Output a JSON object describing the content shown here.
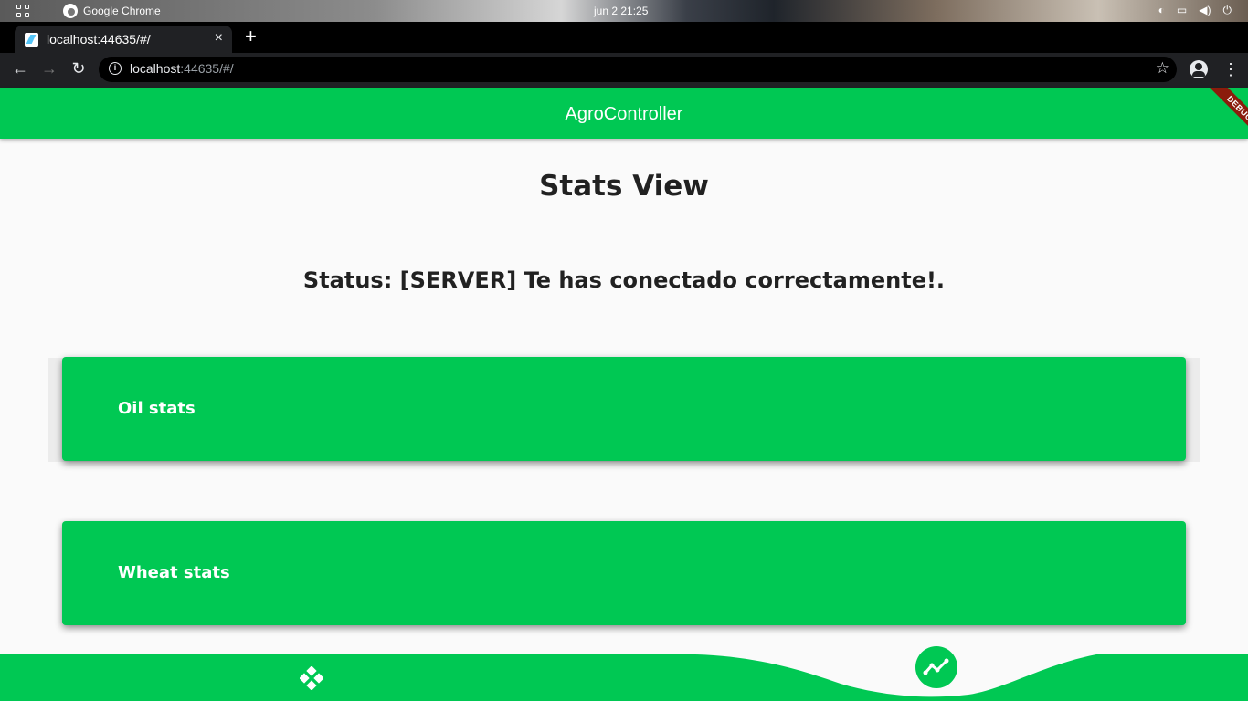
{
  "os": {
    "app_name": "Google Chrome",
    "clock": "jun 2  21:25"
  },
  "browser": {
    "tab_title": "localhost:44635/#/",
    "url_host": "localhost",
    "url_rest": ":44635/#/",
    "new_tab_label": "+",
    "tab_close_label": "×"
  },
  "app": {
    "title": "AgroController",
    "debug_label": "DEBUG",
    "page_title": "Stats View",
    "status": "Status: [SERVER] Te has conectado correctamente!.",
    "cards": [
      {
        "label": "Oil stats"
      },
      {
        "label": "Wheat stats"
      }
    ],
    "accent_color": "#00c853"
  },
  "bottom_nav": {
    "items": [
      {
        "icon": "gamepad-icon",
        "selected": false
      },
      {
        "icon": "trending-up-icon",
        "selected": true
      }
    ]
  }
}
